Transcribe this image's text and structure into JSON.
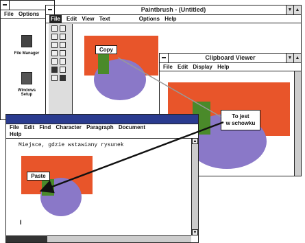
{
  "program_manager": {
    "menu": [
      "File",
      "Options"
    ],
    "icons": [
      {
        "label": "File Manager",
        "icon": "file-cabinet-icon"
      },
      {
        "label": "Windows Setup",
        "icon": "computer-icon"
      }
    ]
  },
  "paintbrush": {
    "title": "Paintbrush - (Untitled)",
    "menu": [
      "File",
      "Edit",
      "View",
      "Text",
      "Options",
      "Help"
    ],
    "callout": "Copy"
  },
  "clipboard": {
    "title": "Clipboard Viewer",
    "menu": [
      "File",
      "Edit",
      "Display",
      "Help"
    ]
  },
  "callout_clipboard": {
    "line1": "To jest",
    "line2": "w schowku"
  },
  "writer": {
    "menu": [
      "File",
      "Edit",
      "Find",
      "Character",
      "Paragraph",
      "Document"
    ],
    "menu2": "Help",
    "text": "Miejsce, gdzie wstawiany rysunek",
    "callout": "Paste",
    "cursor": "I"
  },
  "colors": {
    "orange": "#e8552a",
    "green": "#4a8a2a",
    "purple": "#8a78c8",
    "titlebar_active": "#2a3b8f"
  }
}
